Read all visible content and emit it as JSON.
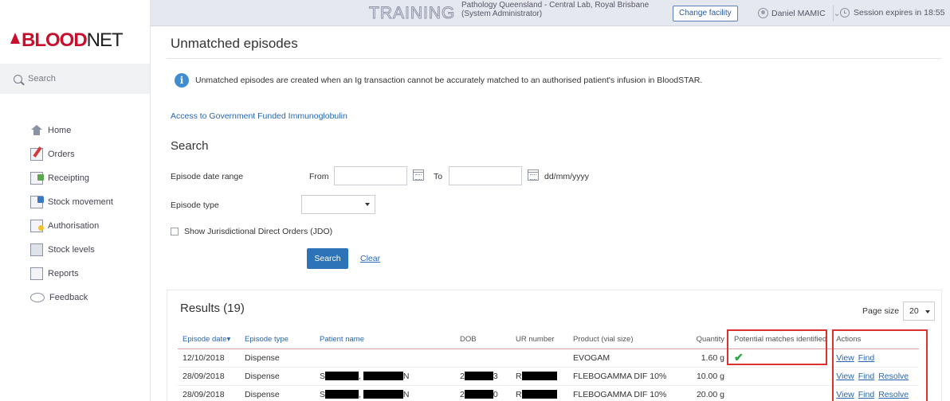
{
  "header": {
    "environment": "TRAINING",
    "facility_line1": "Pathology Queensland - Central Lab, Royal Brisbane",
    "facility_line2": "(System Administrator)",
    "change_facility": "Change facility",
    "user_name": "Daniel MAMIC",
    "session_text": "Session expires in 18:55"
  },
  "sidebar": {
    "logo_blood": "BLOOD",
    "logo_net": "NET",
    "search_label": "Search",
    "items": [
      {
        "label": "Home",
        "icon": "home-icon"
      },
      {
        "label": "Orders",
        "icon": "orders-icon"
      },
      {
        "label": "Receipting",
        "icon": "receipting-icon"
      },
      {
        "label": "Stock movement",
        "icon": "stock-movement-icon"
      },
      {
        "label": "Authorisation",
        "icon": "authorisation-icon"
      },
      {
        "label": "Stock levels",
        "icon": "stock-levels-icon"
      },
      {
        "label": "Reports",
        "icon": "reports-icon"
      },
      {
        "label": "Feedback",
        "icon": "feedback-icon"
      }
    ]
  },
  "main": {
    "title": "Unmatched episodes",
    "info_text": "Unmatched episodes are created when an Ig transaction cannot be accurately matched to an authorised patient's infusion in BloodSTAR.",
    "gov_link": "Access to Government Funded Immunoglobulin",
    "search": {
      "title": "Search",
      "date_range_label": "Episode date range",
      "from_label": "From",
      "to_label": "To",
      "date_format_hint": "dd/mm/yyyy",
      "from_value": "",
      "to_value": "",
      "episode_type_label": "Episode type",
      "episode_type_value": "",
      "jdo_label": "Show Jurisdictional Direct Orders (JDO)",
      "search_button": "Search",
      "clear_link": "Clear"
    },
    "results": {
      "title": "Results (19)",
      "page_size_label": "Page size",
      "page_size_value": "20",
      "columns": [
        "Episode date▾",
        "Episode type",
        "Patient name",
        "DOB",
        "UR number",
        "Product (vial size)",
        "Quantity",
        "Potential matches identified",
        "Actions"
      ],
      "rows": [
        {
          "date": "12/10/2018",
          "type": "Dispense",
          "product": "EVOGAM",
          "quantity": "1.60 g",
          "match": true,
          "actions": [
            "View",
            "Find"
          ]
        },
        {
          "date": "28/09/2018",
          "type": "Dispense",
          "name_start": "S",
          "name_end": "N",
          "dob_start": "2",
          "dob_end": "3",
          "ur_start": "R",
          "product": "FLEBOGAMMA DIF 10%",
          "quantity": "10.00 g",
          "match": false,
          "actions": [
            "View",
            "Find",
            "Resolve"
          ]
        },
        {
          "date": "28/09/2018",
          "type": "Dispense",
          "name_start": "S",
          "name_end": "N",
          "dob_start": "2",
          "dob_end": "0",
          "ur_start": "R",
          "product": "FLEBOGAMMA DIF 10%",
          "quantity": "20.00 g",
          "match": false,
          "actions": [
            "View",
            "Find",
            "Resolve"
          ]
        }
      ]
    }
  },
  "colors": {
    "brand_red": "#c8102e",
    "link_blue": "#2a66b0",
    "button_blue": "#2d73b8",
    "highlight_red": "#d9322f",
    "match_green": "#28a745"
  }
}
